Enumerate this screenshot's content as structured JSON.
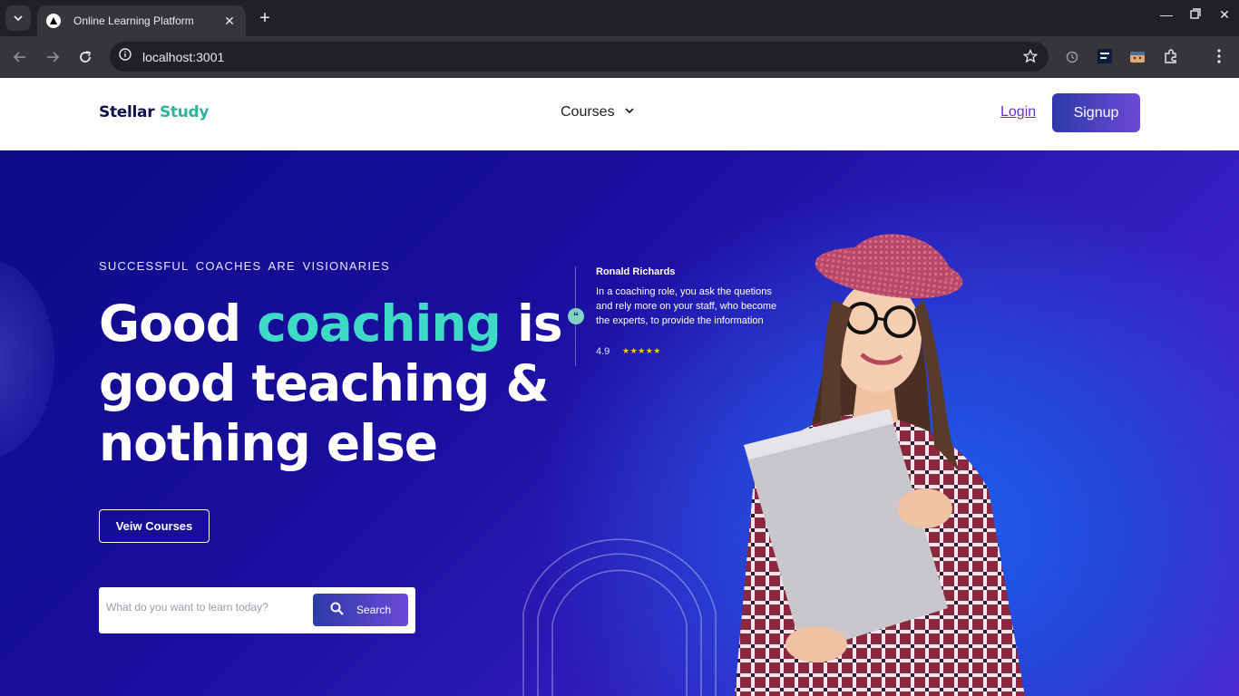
{
  "browser": {
    "tab_title": "Online Learning Platform",
    "url": "localhost:3001",
    "icons": [
      "tab-list-icon",
      "new-tab-icon",
      "minimize-icon",
      "restore-icon",
      "close-icon",
      "back-icon",
      "forward-icon",
      "reload-icon",
      "site-info-icon",
      "bookmark-star-icon",
      "alarm-extension-icon",
      "dictionary-extension-icon",
      "cat-extension-icon",
      "extensions-icon",
      "menu-icon"
    ]
  },
  "header": {
    "logo_part1": "Stellar",
    "logo_part2": "Study",
    "nav_courses": "Courses",
    "login": "Login",
    "signup": "Signup"
  },
  "hero": {
    "tagline": "SUCCESSFUL COACHES ARE VISIONARIES",
    "headline_1": "Good",
    "headline_accent": "coaching",
    "headline_2": "is good teaching & nothing else",
    "view_courses": "Veiw Courses",
    "search_placeholder": "What do you want to learn today?",
    "search_button": "Search"
  },
  "review": {
    "quote_mark": "“",
    "name": "Ronald Richards",
    "text": "In a coaching role, you ask the quetions and rely more on your staff, who become the experts, to provide the information",
    "rating": "4.9",
    "stars": "★★★★★"
  },
  "colors": {
    "brand_dark": "#13104f",
    "brand_teal": "#2fb29a",
    "accent_teal": "#3ddbc6",
    "link_purple": "#6a2ed8",
    "hero_deep": "#0e0a86",
    "hero_blue": "#1a5ff0"
  }
}
